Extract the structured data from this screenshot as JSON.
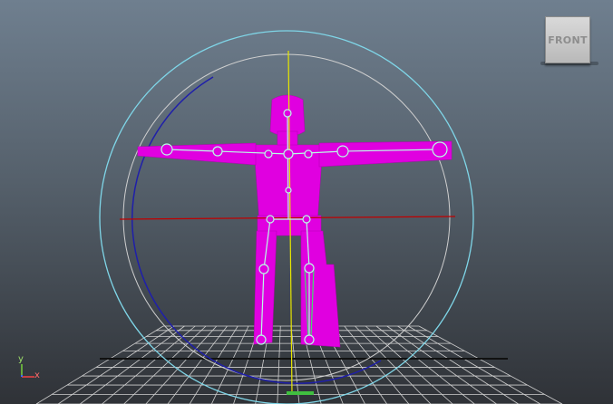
{
  "viewport": {
    "view_cube_label": "FRONT",
    "axis": {
      "y": "y",
      "x": "x"
    }
  },
  "colors": {
    "mesh": "#e000e0",
    "joints": "#b9ffe6",
    "control_circle_outer": "#7fd6e8",
    "control_circle_inner": "#cfcfcf",
    "control_arc": "#1f1faa",
    "axis_x": "#c00000",
    "axis_y": "#e6e600",
    "grid": "#cfcfcf"
  }
}
